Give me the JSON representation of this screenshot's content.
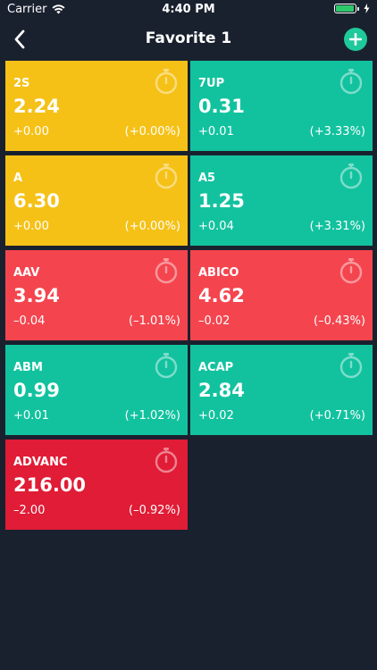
{
  "status_bar": {
    "carrier": "Carrier",
    "time": "4:40 PM"
  },
  "nav": {
    "title": "Favorite 1"
  },
  "colors": {
    "background": "#1a212e",
    "up": "#12c29f",
    "unchanged": "#f5c117",
    "down": "#f4454f",
    "down_strong": "#e01c36",
    "add_button": "#1ec99a"
  },
  "stocks": [
    {
      "symbol": "2S",
      "price": "2.24",
      "change": "+0.00",
      "percent": "(+0.00%)",
      "color": "yellow"
    },
    {
      "symbol": "7UP",
      "price": "0.31",
      "change": "+0.01",
      "percent": "(+3.33%)",
      "color": "green"
    },
    {
      "symbol": "A",
      "price": "6.30",
      "change": "+0.00",
      "percent": "(+0.00%)",
      "color": "yellow"
    },
    {
      "symbol": "A5",
      "price": "1.25",
      "change": "+0.04",
      "percent": "(+3.31%)",
      "color": "green"
    },
    {
      "symbol": "AAV",
      "price": "3.94",
      "change": "–0.04",
      "percent": "(–1.01%)",
      "color": "red"
    },
    {
      "symbol": "ABICO",
      "price": "4.62",
      "change": "–0.02",
      "percent": "(–0.43%)",
      "color": "red"
    },
    {
      "symbol": "ABM",
      "price": "0.99",
      "change": "+0.01",
      "percent": "(+1.02%)",
      "color": "green"
    },
    {
      "symbol": "ACAP",
      "price": "2.84",
      "change": "+0.02",
      "percent": "(+0.71%)",
      "color": "green"
    },
    {
      "symbol": "ADVANC",
      "price": "216.00",
      "change": "–2.00",
      "percent": "(–0.92%)",
      "color": "darkred"
    }
  ]
}
